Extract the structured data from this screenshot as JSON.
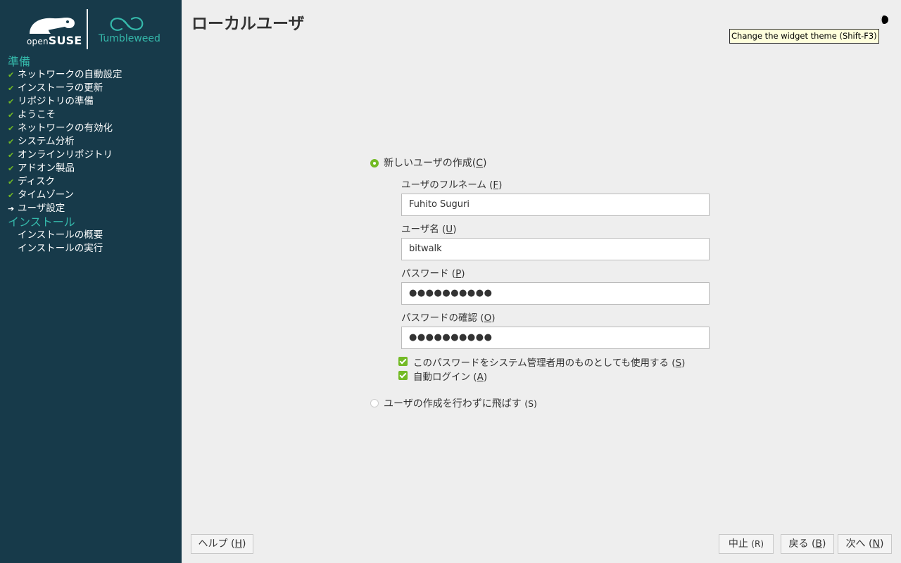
{
  "sidebar": {
    "brand": {
      "open": "open",
      "suse": "SUSE",
      "product": "Tumbleweed"
    },
    "sections": [
      {
        "title": "準備"
      },
      {
        "title": "インストール"
      }
    ],
    "steps_prep": [
      {
        "label": "ネットワークの自動設定",
        "state": "done"
      },
      {
        "label": "インストーラの更新",
        "state": "done"
      },
      {
        "label": "リポジトリの準備",
        "state": "done"
      },
      {
        "label": "ようこそ",
        "state": "done"
      },
      {
        "label": "ネットワークの有効化",
        "state": "done"
      },
      {
        "label": "システム分析",
        "state": "done"
      },
      {
        "label": "オンラインリポジトリ",
        "state": "done"
      },
      {
        "label": "アドオン製品",
        "state": "done"
      },
      {
        "label": "ディスク",
        "state": "done"
      },
      {
        "label": "タイムゾーン",
        "state": "done"
      },
      {
        "label": "ユーザ設定",
        "state": "current"
      }
    ],
    "steps_install": [
      {
        "label": "インストールの概要",
        "state": "pending"
      },
      {
        "label": "インストールの実行",
        "state": "pending"
      }
    ]
  },
  "header": {
    "title": "ローカルユーザ",
    "theme_tooltip": "Change the widget theme (Shift-F3)"
  },
  "form": {
    "create_user": {
      "label": "新しいユーザの作成",
      "accel": "C",
      "selected": true
    },
    "fullname": {
      "label": "ユーザのフルネーム",
      "accel": "F",
      "value": "Fuhito Suguri"
    },
    "username": {
      "label": "ユーザ名",
      "accel": "U",
      "value": "bitwalk"
    },
    "password": {
      "label": "パスワード",
      "accel": "P",
      "value": "●●●●●●●●●●"
    },
    "password_confirm": {
      "label": "パスワードの確認",
      "accel": "O",
      "value": "●●●●●●●●●●"
    },
    "use_for_admin": {
      "label": "このパスワードをシステム管理者用のものとしても使用する",
      "accel": "S",
      "checked": true
    },
    "autologin": {
      "label": "自動ログイン",
      "accel": "A",
      "checked": true
    },
    "skip_user": {
      "label": "ユーザの作成を行わずに飛ばす",
      "accel_text": "(S)",
      "selected": false
    }
  },
  "buttons": {
    "help": {
      "label": "ヘルプ",
      "accel": "H"
    },
    "abort": {
      "label": "中止",
      "accel_text": "(R)"
    },
    "back": {
      "label": "戻る",
      "accel": "B"
    },
    "next": {
      "label": "次へ",
      "accel": "N"
    }
  },
  "colors": {
    "sidebar_bg": "#173a4a",
    "accent_green": "#73ba25",
    "accent_teal": "#35b9ab"
  }
}
